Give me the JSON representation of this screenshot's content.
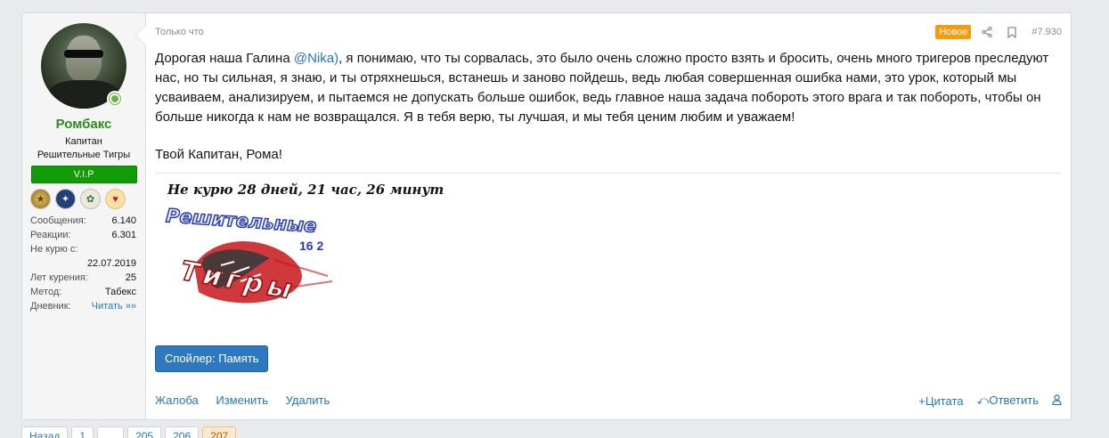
{
  "user": {
    "name": "Ромбакс",
    "title": "Капитан",
    "group": "Решительные Тигры",
    "vip_label": "V.I.P",
    "stats": [
      {
        "label": "Сообщения:",
        "value": "6.140"
      },
      {
        "label": "Реакции:",
        "value": "6.301"
      },
      {
        "label": "Не курю с:",
        "value": ""
      },
      {
        "label": "Лет курения:",
        "value": "25"
      },
      {
        "label": "Метод:",
        "value": "Табекс"
      },
      {
        "label": "Дневник:",
        "value": "Читать »»"
      }
    ],
    "quit_date": "22.07.2019",
    "badges": [
      "medal-icon",
      "group-icon",
      "tiger-icon",
      "award-icon"
    ]
  },
  "post": {
    "time": "Только что",
    "new_label": "Новое",
    "number": "#7.930",
    "text_before": "Дорогая наша Галина ",
    "mention": "@Nika)",
    "text_after": ", я понимаю, что ты сорвалась, это было очень сложно просто взять и бросить, очень много тригеров преследуют нас, но ты сильная, я знаю, и ты отряхнешься, встанешь и заново пойдешь, ведь любая совершенная ошибка нами, это урок, который мы усваиваем, анализируем, и пытаемся не допускать больше ошибок, ведь главное наша задача побороть этого врага и так побороть, чтобы он больше никогда к нам не возвращался. Я в тебя верю, ты лучшая, и мы тебя ценим любим и уважаем!",
    "sign_off": "Твой Капитан, Рома!",
    "signature_text": "Не курю  28 дней, 21 час, 26 минут",
    "logo_text_1": "Решительные",
    "logo_text_2": "Тигры",
    "logo_badge": "16 2",
    "spoiler_label": "Спойлер: Память",
    "actions_left": [
      "Жалоба",
      "Изменить",
      "Удалить"
    ],
    "quote_label": "Цитата",
    "reply_label": "Ответить"
  },
  "pager": [
    "Назад",
    "1",
    "…",
    "205",
    "206",
    "207"
  ]
}
